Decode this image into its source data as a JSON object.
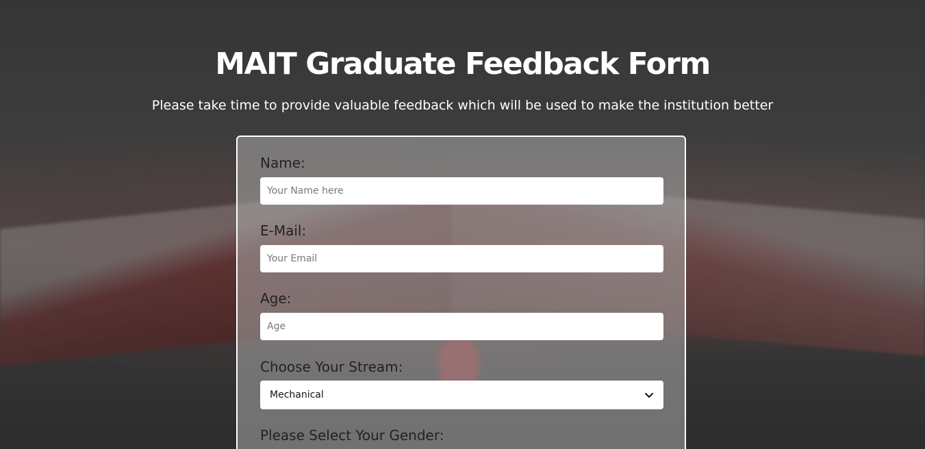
{
  "header": {
    "title": "MAIT Graduate Feedback Form",
    "description": "Please take time to provide valuable feedback which will be used to make the institution better"
  },
  "form": {
    "name": {
      "label": "Name:",
      "placeholder": "Your Name here",
      "value": ""
    },
    "email": {
      "label": "E-Mail:",
      "placeholder": "Your Email",
      "value": ""
    },
    "age": {
      "label": "Age:",
      "placeholder": "Age",
      "value": ""
    },
    "stream": {
      "label": "Choose Your Stream:",
      "selected": "Mechanical"
    },
    "gender": {
      "label": "Please Select Your Gender:"
    }
  },
  "icons": {
    "dropdown": "chevron-down-icon"
  },
  "colors": {
    "title_text": "#ffffff",
    "card_border": "#ffffff",
    "label_text": "#222222",
    "input_background": "#ffffff"
  }
}
